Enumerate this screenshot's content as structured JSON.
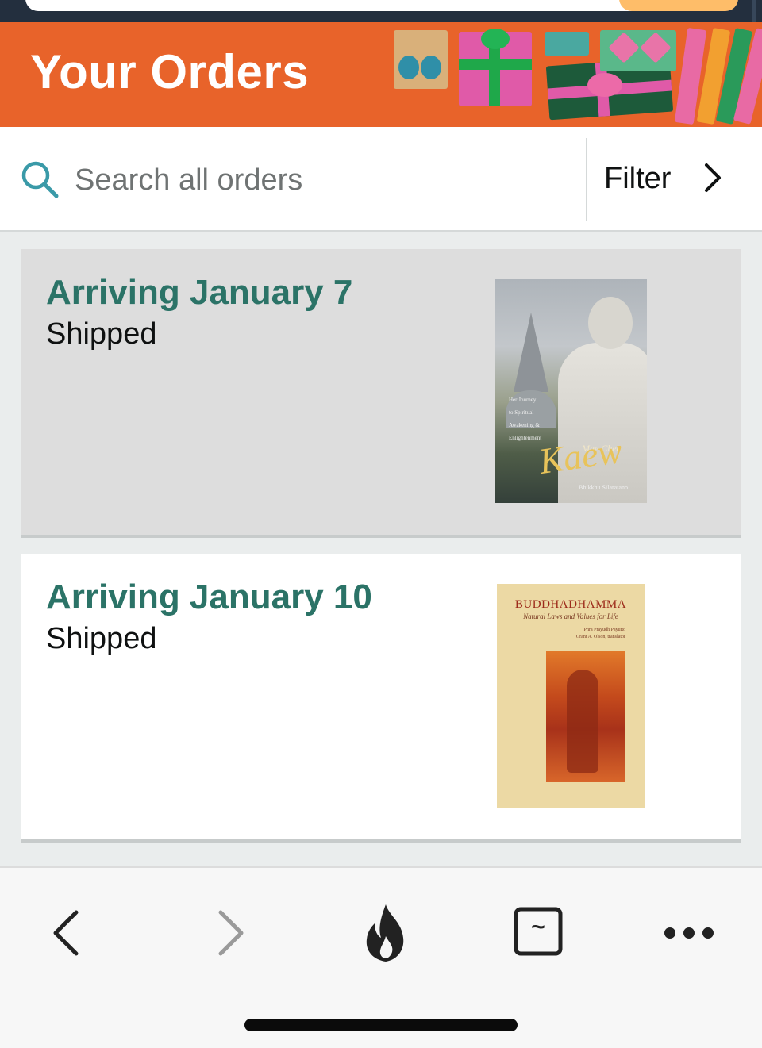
{
  "header": {
    "title": "Your Orders"
  },
  "search": {
    "placeholder": "Search all orders",
    "filter_label": "Filter"
  },
  "orders": [
    {
      "arrival": "Arriving January 7",
      "status": "Shipped",
      "cover": {
        "title": "Kaew",
        "subtitle": "Mae Chee",
        "tagline": [
          "Her Journey",
          "to Spiritual",
          "Awakening &",
          "Enlightenment"
        ],
        "author": "Bhikkhu Silaratano"
      }
    },
    {
      "arrival": "Arriving January 10",
      "status": "Shipped",
      "cover": {
        "title": "BUDDHADHAMMA",
        "subtitle": "Natural Laws and Values for Life",
        "authors": [
          "Phra Prayudh Payutto",
          "Grant A. Olson, translator"
        ]
      }
    }
  ],
  "toolbar": {
    "buttons": [
      "back-icon",
      "forward-icon",
      "flame-icon",
      "tabs-icon",
      "more-icon"
    ],
    "tabs_glyph": "~"
  },
  "colors": {
    "banner": "#e8632a",
    "accent_teal": "#2b7367",
    "search_icon": "#3a9aa8"
  }
}
